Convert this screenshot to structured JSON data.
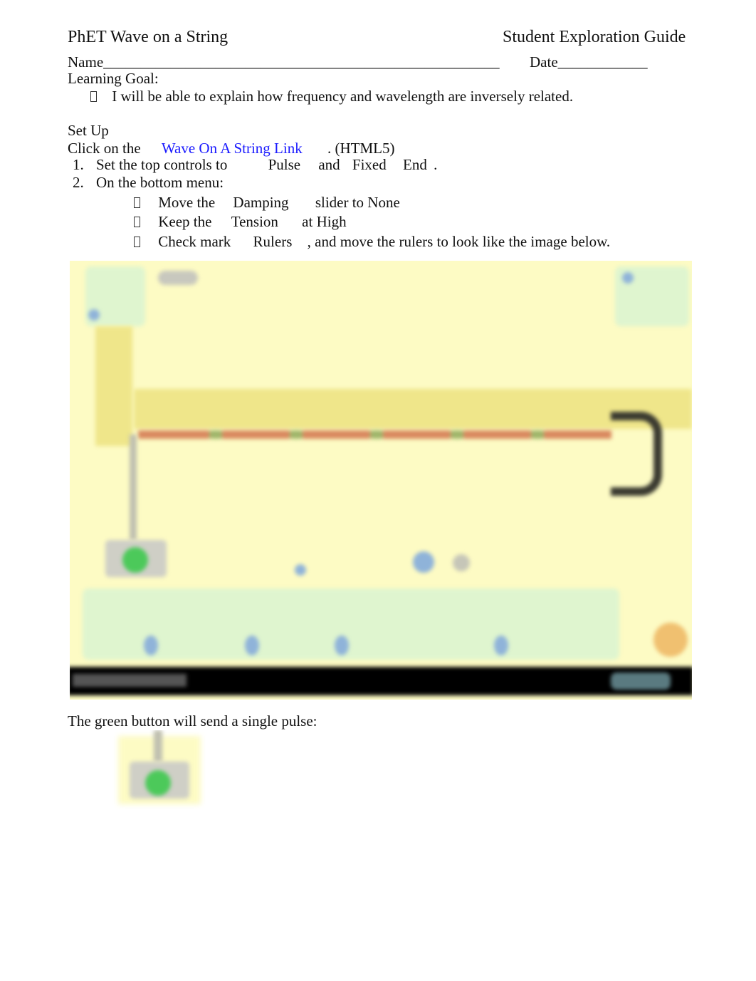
{
  "header": {
    "title_left": "PhET Wave on a String",
    "title_right": "Student Exploration Guide"
  },
  "fields": {
    "name_label": "Name",
    "name_line": "_____________________________________________________",
    "date_label": "Date",
    "date_line": "____________"
  },
  "learning_goal": {
    "heading": "Learning Goal:",
    "items": [
      "I will be able to explain how frequency and wavelength are inversely related."
    ]
  },
  "setup": {
    "heading": "Set Up",
    "click_prefix": "Click on the",
    "link_text": "Wave On A String Link",
    "click_suffix": ". (HTML5)",
    "steps": [
      {
        "number": "1.",
        "parts": [
          "Set the top controls to",
          "Pulse",
          "and",
          "Fixed",
          "End",
          "."
        ]
      },
      {
        "number": "2.",
        "text": "On the bottom menu:",
        "subitems": [
          {
            "parts": [
              "Move the",
              "Damping",
              "slider to None"
            ]
          },
          {
            "parts": [
              "Keep the",
              "Tension",
              "at High"
            ]
          },
          {
            "parts": [
              "Check mark",
              "Rulers",
              ", and move the rulers to look like the image below."
            ]
          }
        ]
      }
    ]
  },
  "simulation_image": {
    "description": "Blurred screenshot of the Wave on a String simulation with rulers and pulse button",
    "colors": {
      "background": "#fdfbc4",
      "ruler": "#efe68a",
      "string": "#d9895f",
      "panel": "#dff5cf",
      "pulse_button": "#4cc95a",
      "footer": "#000000"
    }
  },
  "caption": "The green button will send a single pulse:"
}
